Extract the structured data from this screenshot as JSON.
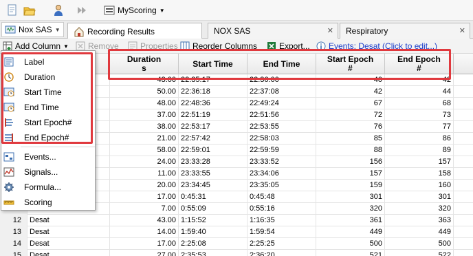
{
  "toolbar": {
    "scoring_label": "MyScoring"
  },
  "recording_dropdown": {
    "value": "Nox SAS"
  },
  "tabs": [
    {
      "label": "Recording Results",
      "active": true
    },
    {
      "label": "NOX SAS",
      "active": false
    },
    {
      "label": "Respiratory",
      "active": false
    }
  ],
  "actions": {
    "add_column": "Add Column",
    "remove": "Remove",
    "properties": "Properties",
    "reorder": "Reorder Columns",
    "export": "Export...",
    "events_link": "Events: Desat (Click to edit...)"
  },
  "columns": [
    {
      "line1": "Duration",
      "line2": "s"
    },
    {
      "line1": "Start Time",
      "line2": ""
    },
    {
      "line1": "End Time",
      "line2": ""
    },
    {
      "line1": "Start Epoch",
      "line2": "#"
    },
    {
      "line1": "End Epoch",
      "line2": "#"
    }
  ],
  "rows": [
    {
      "num": "",
      "label": "",
      "duration": "43.00",
      "start": "22:35:17",
      "end": "22:36:00",
      "sepoch": "40",
      "eepoch": "42"
    },
    {
      "num": "",
      "label": "",
      "duration": "50.00",
      "start": "22:36:18",
      "end": "22:37:08",
      "sepoch": "42",
      "eepoch": "44"
    },
    {
      "num": "",
      "label": "",
      "duration": "48.00",
      "start": "22:48:36",
      "end": "22:49:24",
      "sepoch": "67",
      "eepoch": "68"
    },
    {
      "num": "",
      "label": "",
      "duration": "37.00",
      "start": "22:51:19",
      "end": "22:51:56",
      "sepoch": "72",
      "eepoch": "73"
    },
    {
      "num": "",
      "label": "",
      "duration": "38.00",
      "start": "22:53:17",
      "end": "22:53:55",
      "sepoch": "76",
      "eepoch": "77"
    },
    {
      "num": "",
      "label": "",
      "duration": "21.00",
      "start": "22:57:42",
      "end": "22:58:03",
      "sepoch": "85",
      "eepoch": "86"
    },
    {
      "num": "",
      "label": "",
      "duration": "58.00",
      "start": "22:59:01",
      "end": "22:59:59",
      "sepoch": "88",
      "eepoch": "89"
    },
    {
      "num": "",
      "label": "",
      "duration": "24.00",
      "start": "23:33:28",
      "end": "23:33:52",
      "sepoch": "156",
      "eepoch": "157"
    },
    {
      "num": "",
      "label": "",
      "duration": "11.00",
      "start": "23:33:55",
      "end": "23:34:06",
      "sepoch": "157",
      "eepoch": "158"
    },
    {
      "num": "",
      "label": "",
      "duration": "20.00",
      "start": "23:34:45",
      "end": "23:35:05",
      "sepoch": "159",
      "eepoch": "160"
    },
    {
      "num": "",
      "label": "",
      "duration": "17.00",
      "start": "0:45:31",
      "end": "0:45:48",
      "sepoch": "301",
      "eepoch": "301"
    },
    {
      "num": "",
      "label": "",
      "duration": "7.00",
      "start": "0:55:09",
      "end": "0:55:16",
      "sepoch": "320",
      "eepoch": "320"
    },
    {
      "num": "12",
      "label": "Desat",
      "duration": "43.00",
      "start": "1:15:52",
      "end": "1:16:35",
      "sepoch": "361",
      "eepoch": "363"
    },
    {
      "num": "13",
      "label": "Desat",
      "duration": "14.00",
      "start": "1:59:40",
      "end": "1:59:54",
      "sepoch": "449",
      "eepoch": "449"
    },
    {
      "num": "14",
      "label": "Desat",
      "duration": "17.00",
      "start": "2:25:08",
      "end": "2:25:25",
      "sepoch": "500",
      "eepoch": "500"
    },
    {
      "num": "15",
      "label": "Desat",
      "duration": "27.00",
      "start": "2:35:53",
      "end": "2:36:20",
      "sepoch": "521",
      "eepoch": "522"
    }
  ],
  "menu": {
    "column_items": [
      {
        "label": "Label",
        "icon": "label-icon"
      },
      {
        "label": "Duration",
        "icon": "duration-icon"
      },
      {
        "label": "Start Time",
        "icon": "start-time-icon"
      },
      {
        "label": "End Time",
        "icon": "end-time-icon"
      },
      {
        "label": "Start Epoch#",
        "icon": "start-epoch-icon"
      },
      {
        "label": "End Epoch#",
        "icon": "end-epoch-icon"
      }
    ],
    "other_items": [
      {
        "label": "Events...",
        "icon": "events-icon"
      },
      {
        "label": "Signals...",
        "icon": "signals-icon"
      },
      {
        "label": "Formula...",
        "icon": "formula-icon"
      },
      {
        "label": "Scoring",
        "icon": "scoring-icon"
      }
    ]
  },
  "colors": {
    "highlight": "#e0393e",
    "link": "#1a3cc8"
  }
}
